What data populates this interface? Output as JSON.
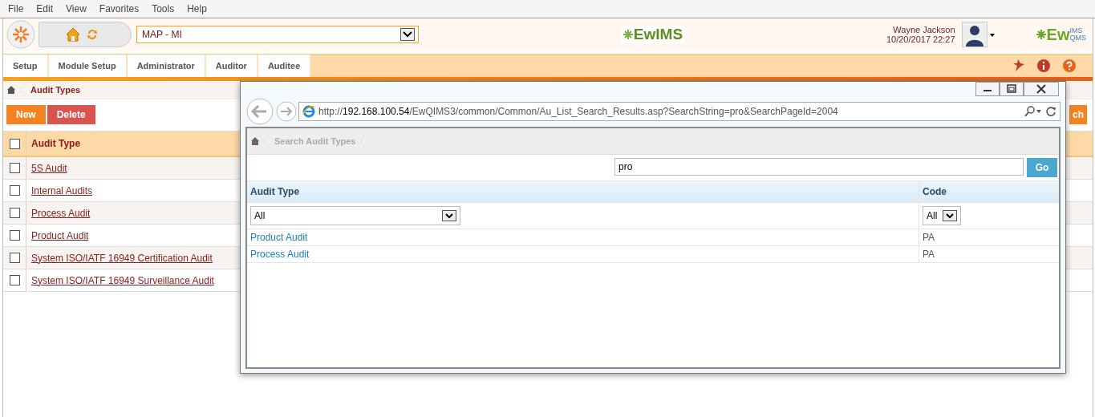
{
  "menu_bar": [
    "File",
    "Edit",
    "View",
    "Favorites",
    "Tools",
    "Help"
  ],
  "header": {
    "site_select": "MAP - MI",
    "center_logo": "EwIMS",
    "user_name": "Wayne Jackson",
    "datetime": "10/20/2017 22:27",
    "right_logo": {
      "main": "Ew",
      "top": "IMS",
      "bottom": "QMS"
    }
  },
  "nav_tabs": [
    {
      "label": "Setup",
      "selected": false
    },
    {
      "label": "Module Setup",
      "selected": false
    },
    {
      "label": "Administrator",
      "selected": false
    },
    {
      "label": "Auditor",
      "selected": false
    },
    {
      "label": "Auditee",
      "selected": false
    }
  ],
  "breadcrumb": "Audit Types",
  "buttons": [
    {
      "label": "New",
      "kind": "primary"
    },
    {
      "label": "Delete",
      "kind": "danger"
    },
    {
      "label": "ch",
      "kind": "primary"
    }
  ],
  "table": {
    "columns": [
      "Audit Type"
    ],
    "header_checked": false,
    "rows": [
      {
        "name": "5S Audit",
        "checked": false
      },
      {
        "name": "Internal Audits",
        "checked": false
      },
      {
        "name": "Process Audit",
        "checked": false
      },
      {
        "name": "Product Audit",
        "checked": false
      },
      {
        "name": "System ISO/IATF 16949 Certification Audit",
        "checked": false
      },
      {
        "name": "System ISO/IATF 16949 Surveillance Audit",
        "checked": false
      }
    ]
  },
  "popup": {
    "url": {
      "scheme": "http://",
      "host": "192.168.100.54",
      "path": "/EwQIMS3/common/Common/Au_List_Search_Results.asp?SearchString=pro&SearchPageId=2004"
    },
    "breadcrumb": "Search Audit Types",
    "search_value": "pro",
    "go_button": "Go",
    "columns": [
      "Audit Type",
      "Code"
    ],
    "filters": [
      "All",
      "All"
    ],
    "rows": [
      [
        "Product Audit",
        "PA"
      ],
      [
        "Process Audit",
        "PA"
      ]
    ]
  }
}
